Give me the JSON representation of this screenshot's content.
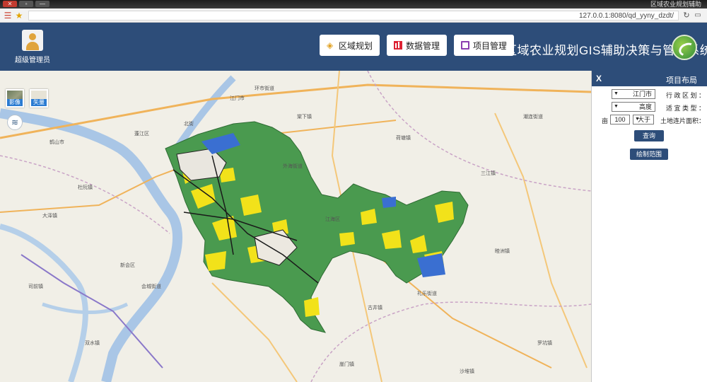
{
  "browser": {
    "window_title": "区域农业规划辅助",
    "url": "127.0.0.1:8080/qd_yyny_dzdt/",
    "buttons": {
      "minimize": "—",
      "maximize": "▫",
      "close": "✕"
    }
  },
  "header": {
    "app_title": "区域农业规划GIS辅助决策与管理系统",
    "user_label": "超级管理员",
    "nav": [
      {
        "label": "区域规划",
        "icon": "map-pin-icon"
      },
      {
        "label": "数据管理",
        "icon": "chart-icon"
      },
      {
        "label": "项目管理",
        "icon": "monitor-icon"
      }
    ],
    "colors": {
      "header_bg": "#2d4d79"
    }
  },
  "map": {
    "basemap_options": [
      {
        "label": "影像"
      },
      {
        "label": "矢量"
      }
    ],
    "labels": [
      "江门市",
      "鹤山市",
      "蓬江区",
      "新会区",
      "杜阮镇",
      "棠下镇",
      "荷塘镇",
      "大泽镇",
      "司前镇",
      "会城街道",
      "三江镇",
      "睦洲镇",
      "罗坑镇",
      "古井镇",
      "双水镇",
      "崖门镇",
      "沙堆镇",
      "外海街道",
      "江海区",
      "礼乐街道",
      "北街",
      "环市街道",
      "潮连街道"
    ],
    "colors": {
      "region_green": "#4a9a4f",
      "farmland_yellow": "#f2e21a",
      "water_blue": "#3a6fd1"
    }
  },
  "panel": {
    "title": "项目布局",
    "close": "X",
    "fields": {
      "admin_region_label": "行 政 区 划 ：",
      "admin_region_value": "江门市",
      "suitability_label": "适 宜 类 型 ：",
      "suitability_value": "高度",
      "area_label": "土地连片面积：",
      "area_operator": "大于",
      "area_value": "100",
      "area_unit": "亩"
    },
    "buttons": {
      "query": "查询",
      "draw_range": "绘制范围"
    }
  }
}
